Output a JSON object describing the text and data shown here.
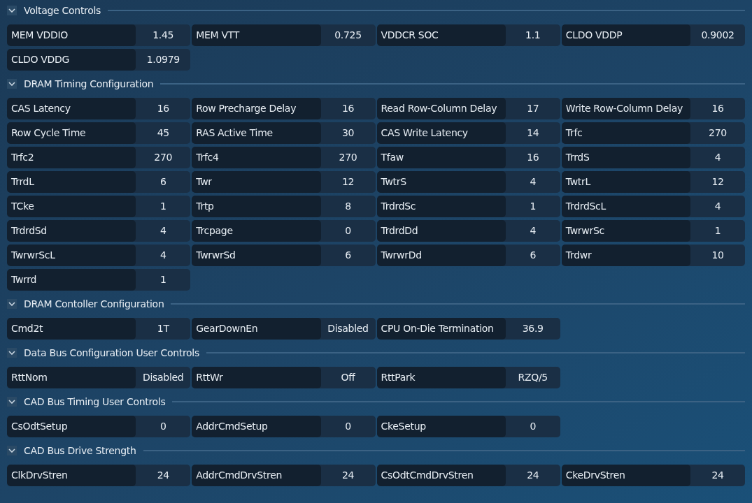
{
  "sections": [
    {
      "title": "Voltage Controls",
      "expanded": true,
      "items": [
        {
          "label": "MEM VDDIO",
          "value": "1.45"
        },
        {
          "label": "MEM VTT",
          "value": "0.725"
        },
        {
          "label": "VDDCR SOC",
          "value": "1.1"
        },
        {
          "label": "CLDO VDDP",
          "value": "0.9002"
        },
        {
          "label": "CLDO VDDG",
          "value": "1.0979"
        }
      ]
    },
    {
      "title": "DRAM Timing Configuration",
      "expanded": true,
      "items": [
        {
          "label": "CAS Latency",
          "value": "16"
        },
        {
          "label": "Row Precharge Delay",
          "value": "16"
        },
        {
          "label": "Read Row-Column Delay",
          "value": "17"
        },
        {
          "label": "Write Row-Column Delay",
          "value": "16"
        },
        {
          "label": "Row Cycle Time",
          "value": "45"
        },
        {
          "label": "RAS Active Time",
          "value": "30"
        },
        {
          "label": "CAS Write Latency",
          "value": "14"
        },
        {
          "label": "Trfc",
          "value": "270"
        },
        {
          "label": "Trfc2",
          "value": "270"
        },
        {
          "label": "Trfc4",
          "value": "270"
        },
        {
          "label": "Tfaw",
          "value": "16"
        },
        {
          "label": "TrrdS",
          "value": "4"
        },
        {
          "label": "TrrdL",
          "value": "6"
        },
        {
          "label": "Twr",
          "value": "12"
        },
        {
          "label": "TwtrS",
          "value": "4"
        },
        {
          "label": "TwtrL",
          "value": "12"
        },
        {
          "label": "TCke",
          "value": "1"
        },
        {
          "label": "Trtp",
          "value": "8"
        },
        {
          "label": "TrdrdSc",
          "value": "1"
        },
        {
          "label": "TrdrdScL",
          "value": "4"
        },
        {
          "label": "TrdrdSd",
          "value": "4"
        },
        {
          "label": "Trcpage",
          "value": "0"
        },
        {
          "label": "TrdrdDd",
          "value": "4"
        },
        {
          "label": "TwrwrSc",
          "value": "1"
        },
        {
          "label": "TwrwrScL",
          "value": "4"
        },
        {
          "label": "TwrwrSd",
          "value": "6"
        },
        {
          "label": "TwrwrDd",
          "value": "6"
        },
        {
          "label": "Trdwr",
          "value": "10"
        },
        {
          "label": "Twrrd",
          "value": "1"
        }
      ]
    },
    {
      "title": "DRAM Contoller Configuration",
      "expanded": true,
      "items": [
        {
          "label": "Cmd2t",
          "value": "1T"
        },
        {
          "label": "GearDownEn",
          "value": "Disabled"
        },
        {
          "label": "CPU On-Die Termination",
          "value": "36.9"
        }
      ]
    },
    {
      "title": "Data Bus Configuration User Controls",
      "expanded": true,
      "items": [
        {
          "label": "RttNom",
          "value": "Disabled"
        },
        {
          "label": "RttWr",
          "value": "Off"
        },
        {
          "label": "RttPark",
          "value": "RZQ/5"
        }
      ]
    },
    {
      "title": "CAD Bus Timing User Controls",
      "expanded": true,
      "items": [
        {
          "label": "CsOdtSetup",
          "value": "0"
        },
        {
          "label": "AddrCmdSetup",
          "value": "0"
        },
        {
          "label": "CkeSetup",
          "value": "0"
        }
      ]
    },
    {
      "title": "CAD Bus Drive Strength",
      "expanded": true,
      "items": [
        {
          "label": "ClkDrvStren",
          "value": "24"
        },
        {
          "label": "AddrCmdDrvStren",
          "value": "24"
        },
        {
          "label": "CsOdtCmdDrvStren",
          "value": "24"
        },
        {
          "label": "CkeDrvStren",
          "value": "24"
        }
      ]
    }
  ]
}
